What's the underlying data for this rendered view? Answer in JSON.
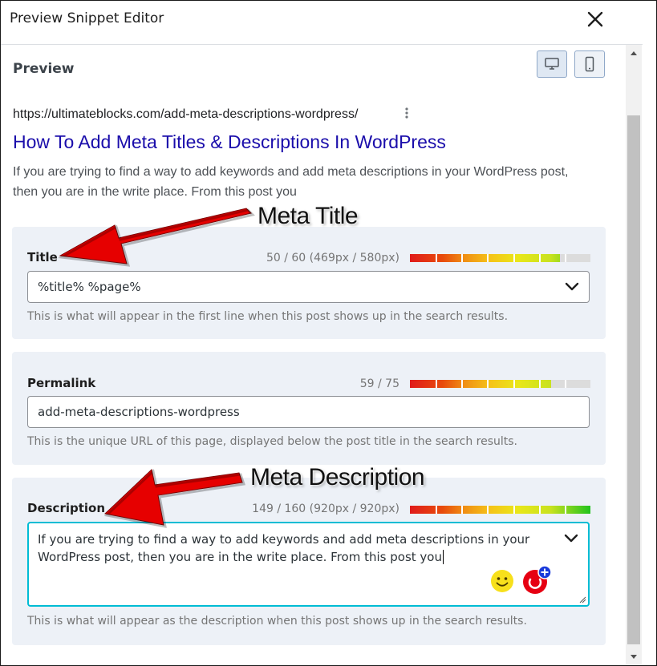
{
  "header": {
    "title": "Preview Snippet Editor"
  },
  "preview": {
    "label": "Preview",
    "url": "https://ultimateblocks.com/add-meta-descriptions-wordpress/",
    "title": "How To Add Meta Titles & Descriptions In WordPress",
    "description": "If you are trying to find a way to add keywords and add meta descriptions in your WordPress post, then you are in the write place. From this post you"
  },
  "fields": {
    "title": {
      "label": "Title",
      "counter": "50 / 60 (469px / 580px)",
      "fill": 0.83,
      "value": "%title% %page%",
      "help": "This is what will appear in the first line when this post shows up in the search results."
    },
    "permalink": {
      "label": "Permalink",
      "counter": "59 / 75",
      "fill": 0.78,
      "value": "add-meta-descriptions-wordpress",
      "help": "This is the unique URL of this page, displayed below the post title in the search results."
    },
    "description": {
      "label": "Description",
      "counter": "149 / 160 (920px / 920px)",
      "fill": 1.0,
      "value": "If you are trying to find a way to add keywords and add meta descriptions in your WordPress post, then you are in the write place. From this post you",
      "help": "This is what will appear as the description when this post shows up in the search results."
    }
  },
  "annotations": {
    "meta_title": "Meta Title",
    "meta_description": "Meta Description"
  },
  "icons": {
    "close": "close-icon",
    "desktop": "desktop-icon",
    "mobile": "mobile-icon",
    "kebab": "kebab-icon",
    "chevron": "chevron-down-icon",
    "emoji": "emoji-icon",
    "grammarly": "grammarly-icon"
  },
  "colors": {
    "link": "#1a0dab",
    "focus": "#00bcd4",
    "arrow": "#e60000"
  }
}
